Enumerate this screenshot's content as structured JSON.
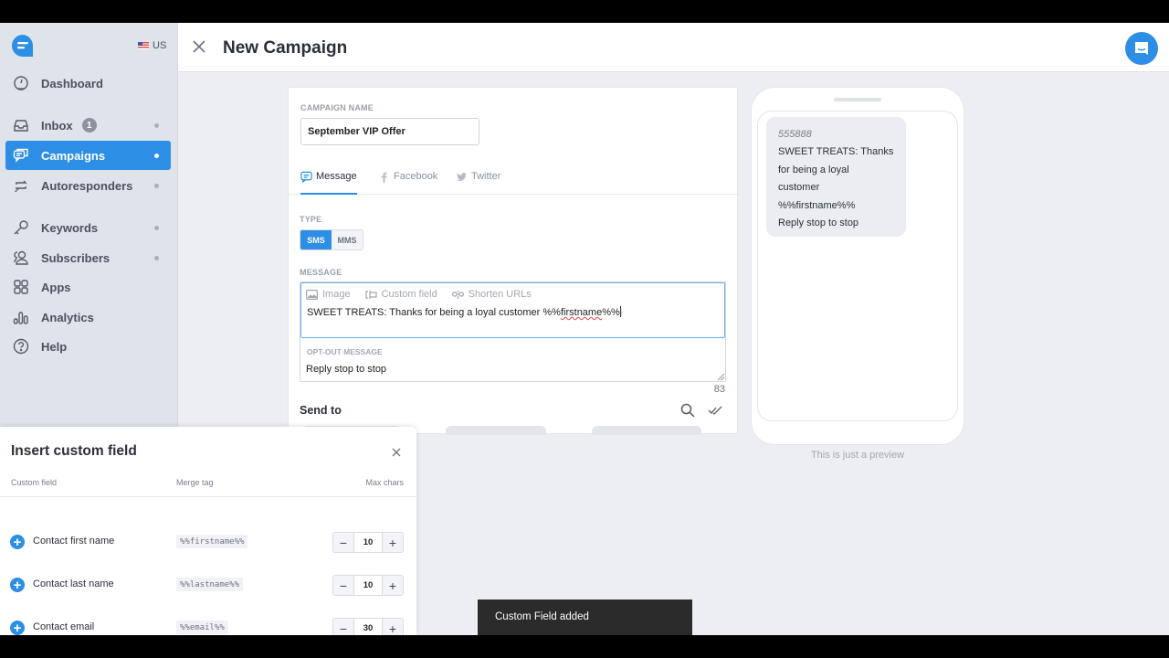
{
  "app": {
    "locale": "US",
    "page_title": "New Campaign"
  },
  "sidebar": {
    "items": [
      {
        "label": "Dashboard",
        "icon": "dashboard-gauge-icon",
        "badge": null,
        "dot": false,
        "active": false
      },
      {
        "label": "Inbox",
        "icon": "inbox-tray-icon",
        "badge": "1",
        "dot": true,
        "active": false
      },
      {
        "label": "Campaigns",
        "icon": "chat-bubbles-icon",
        "badge": null,
        "dot": true,
        "active": true
      },
      {
        "label": "Autoresponders",
        "icon": "loop-arrows-icon",
        "badge": null,
        "dot": true,
        "active": false
      },
      {
        "label": "Keywords",
        "icon": "key-icon",
        "badge": null,
        "dot": true,
        "active": false
      },
      {
        "label": "Subscribers",
        "icon": "users-icon",
        "badge": null,
        "dot": true,
        "active": false
      },
      {
        "label": "Apps",
        "icon": "grid-icon",
        "badge": null,
        "dot": false,
        "active": false
      },
      {
        "label": "Analytics",
        "icon": "bar-chart-icon",
        "badge": null,
        "dot": false,
        "active": false
      },
      {
        "label": "Help",
        "icon": "question-circle-icon",
        "badge": null,
        "dot": false,
        "active": false
      }
    ]
  },
  "form": {
    "campaign_name_label": "CAMPAIGN NAME",
    "campaign_name_value": "September VIP Offer",
    "tabs": [
      {
        "label": "Message",
        "active": true
      },
      {
        "label": "Facebook",
        "active": false
      },
      {
        "label": "Twitter",
        "active": false
      }
    ],
    "type_label": "TYPE",
    "type_options": [
      {
        "label": "SMS",
        "selected": true
      },
      {
        "label": "MMS",
        "selected": false
      }
    ],
    "message_label": "MESSAGE",
    "toolbar": {
      "image": "Image",
      "custom_field": "Custom field",
      "shorten_urls": "Shorten URLs"
    },
    "message_text_prefix": "SWEET TREATS: Thanks for being a loyal customer %%",
    "message_text_misspelled": "firstname",
    "message_text_suffix": "%%",
    "optout_label": "OPT-OUT MESSAGE",
    "optout_value": "Reply stop to stop",
    "char_count": "83",
    "send_to_label": "Send to"
  },
  "preview": {
    "sender": "555888",
    "body": "SWEET TREATS: Thanks\nfor being a loyal\ncustomer\n%%firstname%%\nReply stop to stop",
    "note": "This is just a preview"
  },
  "custom_field_panel": {
    "title": "Insert custom field",
    "columns": {
      "field": "Custom field",
      "tag": "Merge tag",
      "max": "Max chars"
    },
    "rows": [
      {
        "name": "Contact first name",
        "tag": "%%firstname%%",
        "max_chars": "10"
      },
      {
        "name": "Contact last name",
        "tag": "%%lastname%%",
        "max_chars": "10"
      },
      {
        "name": "Contact email",
        "tag": "%%email%%",
        "max_chars": "30"
      }
    ]
  },
  "toast": {
    "message": "Custom Field added"
  },
  "colors": {
    "accent": "#2d8ee6",
    "sidebar_bg": "#dfe3ea",
    "toast_bg": "#2b2b2b"
  }
}
